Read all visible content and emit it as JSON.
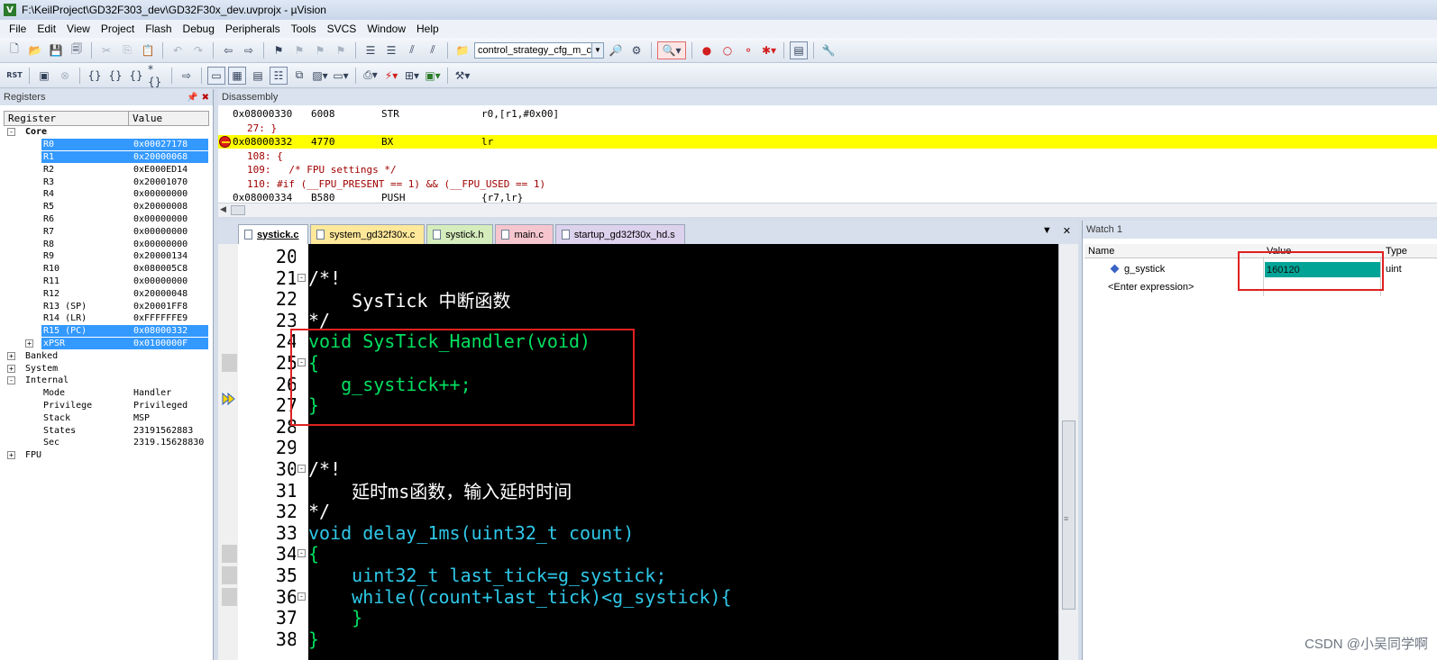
{
  "window": {
    "title": "F:\\KeilProject\\GD32F303_dev\\GD32F30x_dev.uvprojx - µVision"
  },
  "menu": [
    "File",
    "Edit",
    "View",
    "Project",
    "Flash",
    "Debug",
    "Peripherals",
    "Tools",
    "SVCS",
    "Window",
    "Help"
  ],
  "toolbar": {
    "target_combo": "control_strategy_cfg_m_c",
    "rst_label": "RST"
  },
  "registers": {
    "title": "Registers",
    "headers": [
      "Register",
      "Value"
    ],
    "rows": [
      {
        "name": "Core",
        "value": "",
        "level": 0,
        "exp": "-",
        "bold": true
      },
      {
        "name": "R0",
        "value": "0x00027178",
        "level": 2,
        "sel": true
      },
      {
        "name": "R1",
        "value": "0x20000068",
        "level": 2,
        "sel": true
      },
      {
        "name": "R2",
        "value": "0xE000ED14",
        "level": 2
      },
      {
        "name": "R3",
        "value": "0x20001070",
        "level": 2
      },
      {
        "name": "R4",
        "value": "0x00000000",
        "level": 2
      },
      {
        "name": "R5",
        "value": "0x20000008",
        "level": 2
      },
      {
        "name": "R6",
        "value": "0x00000000",
        "level": 2
      },
      {
        "name": "R7",
        "value": "0x00000000",
        "level": 2
      },
      {
        "name": "R8",
        "value": "0x00000000",
        "level": 2
      },
      {
        "name": "R9",
        "value": "0x20000134",
        "level": 2
      },
      {
        "name": "R10",
        "value": "0x080005C8",
        "level": 2
      },
      {
        "name": "R11",
        "value": "0x00000000",
        "level": 2
      },
      {
        "name": "R12",
        "value": "0x20000048",
        "level": 2
      },
      {
        "name": "R13 (SP)",
        "value": "0x20001FF8",
        "level": 2
      },
      {
        "name": "R14 (LR)",
        "value": "0xFFFFFFE9",
        "level": 2
      },
      {
        "name": "R15 (PC)",
        "value": "0x08000332",
        "level": 2,
        "sel": true
      },
      {
        "name": "xPSR",
        "value": "0x0100000F",
        "level": 2,
        "sel": true,
        "exp": "+"
      },
      {
        "name": "Banked",
        "value": "",
        "level": 0,
        "exp": "+"
      },
      {
        "name": "System",
        "value": "",
        "level": 0,
        "exp": "+"
      },
      {
        "name": "Internal",
        "value": "",
        "level": 0,
        "exp": "-"
      },
      {
        "name": "Mode",
        "value": "Handler",
        "level": 2
      },
      {
        "name": "Privilege",
        "value": "Privileged",
        "level": 2
      },
      {
        "name": "Stack",
        "value": "MSP",
        "level": 2
      },
      {
        "name": "States",
        "value": "23191562883",
        "level": 2
      },
      {
        "name": "Sec",
        "value": "2319.15628830",
        "level": 2
      },
      {
        "name": "FPU",
        "value": "",
        "level": 0,
        "exp": "+"
      }
    ]
  },
  "disassembly": {
    "title": "Disassembly",
    "lines": [
      {
        "kind": "asm",
        "addr": "0x08000330",
        "op": "6008",
        "mn": "STR",
        "args": "r0,[r1,#0x00]"
      },
      {
        "kind": "src",
        "text": "27: }"
      },
      {
        "kind": "asm",
        "addr": "0x08000332",
        "op": "4770",
        "mn": "BX",
        "args": "lr",
        "hl": true
      },
      {
        "kind": "src",
        "text": "108: {"
      },
      {
        "kind": "src",
        "text": "109:   /* FPU settings */"
      },
      {
        "kind": "src",
        "text": "110: #if (__FPU_PRESENT == 1) && (__FPU_USED == 1)"
      },
      {
        "kind": "asm",
        "addr": "0x08000334",
        "op": "B580",
        "mn": "PUSH",
        "args": "{r7,lr}"
      }
    ]
  },
  "editor": {
    "tabs": [
      {
        "label": "systick.c",
        "style": "active"
      },
      {
        "label": "system_gd32f30x.c",
        "style": "yellow"
      },
      {
        "label": "systick.h",
        "style": "green"
      },
      {
        "label": "main.c",
        "style": "pink"
      },
      {
        "label": "startup_gd32f30x_hd.s",
        "style": "purple"
      }
    ],
    "lines": [
      {
        "n": "20",
        "text": "",
        "cls": "cmt"
      },
      {
        "n": "21",
        "text": "/*!",
        "cls": "cmt",
        "fold": "-"
      },
      {
        "n": "22",
        "text": "    SysTick 中断函数",
        "cls": "cmt"
      },
      {
        "n": "23",
        "text": "*/",
        "cls": "cmt"
      },
      {
        "n": "24",
        "text": "void SysTick_Handler(void)",
        "cls": "grn"
      },
      {
        "n": "25",
        "text": "{",
        "cls": "grn",
        "fold": "-"
      },
      {
        "n": "26",
        "text": "   g_systick++;",
        "cls": "grn"
      },
      {
        "n": "27",
        "text": "}",
        "cls": "grn"
      },
      {
        "n": "28",
        "text": "",
        "cls": "cmt"
      },
      {
        "n": "29",
        "text": "",
        "cls": "cmt"
      },
      {
        "n": "30",
        "text": "/*!",
        "cls": "cmt",
        "fold": "-"
      },
      {
        "n": "31",
        "text": "    延时ms函数，输入延时时间",
        "cls": "cmt"
      },
      {
        "n": "32",
        "text": "*/",
        "cls": "cmt"
      },
      {
        "n": "33",
        "text": "void delay_1ms(uint32_t count)",
        "cls": "kw"
      },
      {
        "n": "34",
        "text": "{",
        "cls": "grn",
        "fold": "-"
      },
      {
        "n": "35",
        "text": "    uint32_t last_tick=g_systick;",
        "cls": "kw"
      },
      {
        "n": "36",
        "text": "    while((count+last_tick)<g_systick){",
        "cls": "kw",
        "fold": "-"
      },
      {
        "n": "37",
        "text": "    }",
        "cls": "grn"
      },
      {
        "n": "38",
        "text": "}",
        "cls": "grn"
      }
    ]
  },
  "watch": {
    "title": "Watch 1",
    "headers": [
      "Name",
      "Value",
      "Type"
    ],
    "rows": [
      {
        "name": "g_systick",
        "value": "160120",
        "type": "uint"
      },
      {
        "name": "<Enter expression>",
        "value": "",
        "type": ""
      }
    ]
  },
  "watermark": "CSDN @小吴同学啊"
}
